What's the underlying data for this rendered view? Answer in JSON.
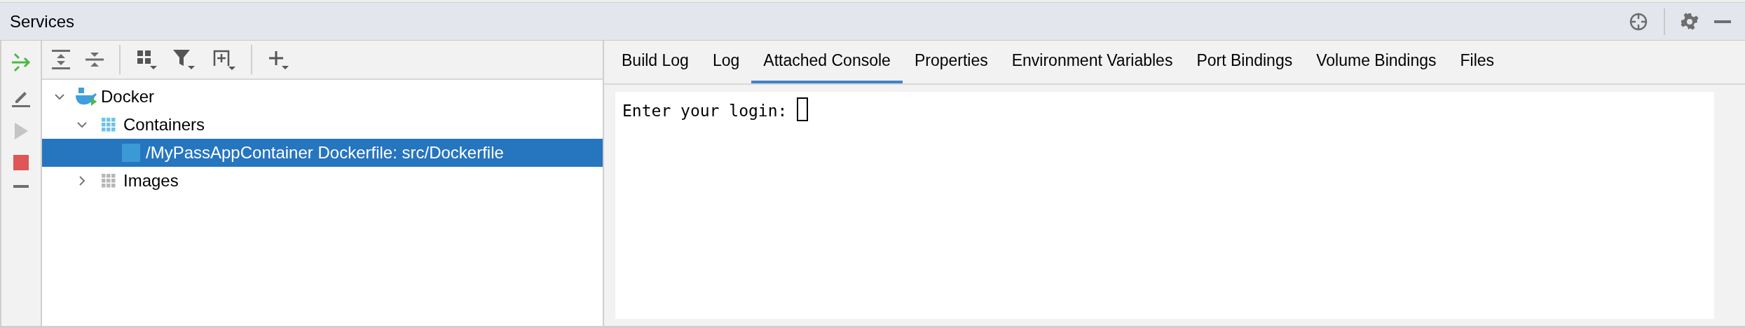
{
  "panel": {
    "title": "Services"
  },
  "tree": [
    {
      "label": "Docker",
      "kind": "docker",
      "expanded": true,
      "selected": false,
      "children": [
        {
          "label": "Containers",
          "kind": "containers",
          "expanded": true,
          "selected": false,
          "children": [
            {
              "label": "/MyPassAppContainer Dockerfile: src/Dockerfile",
              "kind": "container",
              "selected": true
            }
          ]
        },
        {
          "label": "Images",
          "kind": "images",
          "expanded": false,
          "selected": false
        }
      ]
    }
  ],
  "tabs": [
    {
      "label": "Build Log",
      "selected": false
    },
    {
      "label": "Log",
      "selected": false
    },
    {
      "label": "Attached Console",
      "selected": true
    },
    {
      "label": "Properties",
      "selected": false
    },
    {
      "label": "Environment Variables",
      "selected": false
    },
    {
      "label": "Port Bindings",
      "selected": false
    },
    {
      "label": "Volume Bindings",
      "selected": false
    },
    {
      "label": "Files",
      "selected": false
    }
  ],
  "console": {
    "prompt": "Enter your login: "
  }
}
